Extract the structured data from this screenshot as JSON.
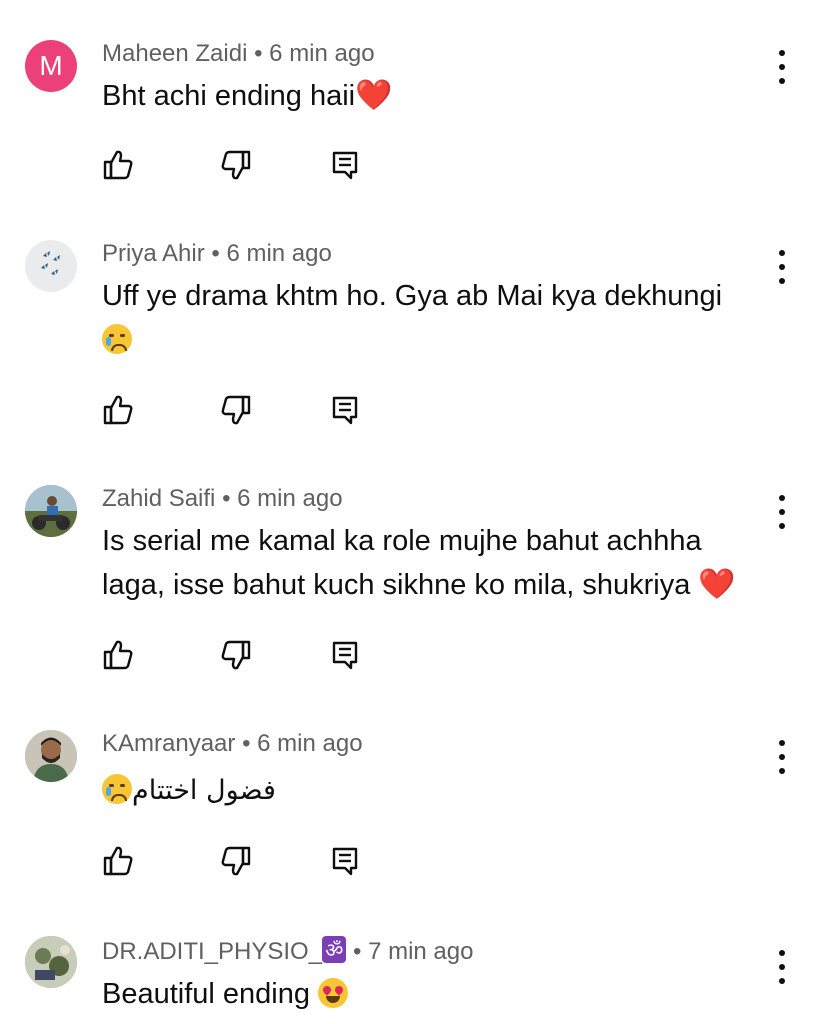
{
  "comments": [
    {
      "author": "Maheen Zaidi",
      "time": "6 min ago",
      "avatar_letter": "M",
      "avatar_color": "#ec407a",
      "text": "Bht achi ending haii",
      "emoji": "❤️"
    },
    {
      "author": "Priya Ahir",
      "time": "6 min ago",
      "text": "Uff ye drama khtm ho. Gya ab Mai kya dekhungi",
      "emoji": "😢"
    },
    {
      "author": "Zahid Saifi",
      "time": "6 min ago",
      "text_line1": "Is serial me kamal ka role mujhe bahut achhha",
      "text_line2": "laga, isse bahut kuch sikhne ko mila, shukriya",
      "emoji": "❤️"
    },
    {
      "author": "KAmranyaar",
      "time": "6 min ago",
      "text": "فضول اختتام",
      "emoji": "😢"
    },
    {
      "author": "DR.ADITI_PHYSIO_",
      "author_badge": "ॐ",
      "time": "7 min ago",
      "text": "Beautiful ending",
      "emoji": "😍"
    }
  ],
  "separator": "•",
  "icons": {
    "like": "thumbs-up-icon",
    "dislike": "thumbs-down-icon",
    "reply": "reply-icon",
    "more": "more-vert-icon"
  }
}
